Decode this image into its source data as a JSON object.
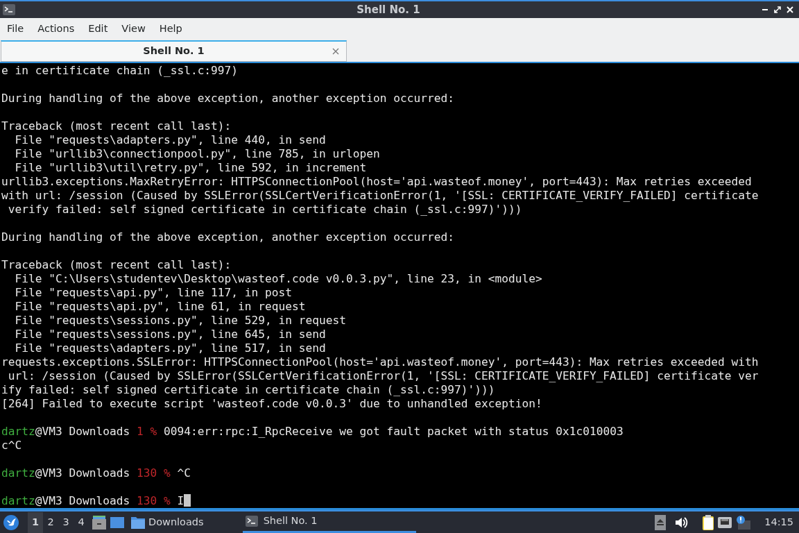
{
  "window": {
    "title": "Shell No. 1"
  },
  "menu": [
    "File",
    "Actions",
    "Edit",
    "View",
    "Help"
  ],
  "tabs": [
    {
      "label": "Shell No. 1",
      "selected": true
    }
  ],
  "terminal": {
    "lines": [
      {
        "kind": "output",
        "text": "e in certificate chain (_ssl.c:997)"
      },
      {
        "kind": "blank"
      },
      {
        "kind": "output",
        "text": "During handling of the above exception, another exception occurred:"
      },
      {
        "kind": "blank"
      },
      {
        "kind": "output",
        "text": "Traceback (most recent call last):"
      },
      {
        "kind": "output",
        "text": "  File \"requests\\adapters.py\", line 440, in send"
      },
      {
        "kind": "output",
        "text": "  File \"urllib3\\connectionpool.py\", line 785, in urlopen"
      },
      {
        "kind": "output",
        "text": "  File \"urllib3\\util\\retry.py\", line 592, in increment"
      },
      {
        "kind": "output",
        "text": "urllib3.exceptions.MaxRetryError: HTTPSConnectionPool(host='api.wasteof.money', port=443): Max retries exceeded"
      },
      {
        "kind": "output",
        "text": "with url: /session (Caused by SSLError(SSLCertVerificationError(1, '[SSL: CERTIFICATE_VERIFY_FAILED] certificate"
      },
      {
        "kind": "output",
        "text": " verify failed: self signed certificate in certificate chain (_ssl.c:997)')))"
      },
      {
        "kind": "blank"
      },
      {
        "kind": "output",
        "text": "During handling of the above exception, another exception occurred:"
      },
      {
        "kind": "blank"
      },
      {
        "kind": "output",
        "text": "Traceback (most recent call last):"
      },
      {
        "kind": "output",
        "text": "  File \"C:\\Users\\studentev\\Desktop\\wasteof.code v0.0.3.py\", line 23, in <module>"
      },
      {
        "kind": "output",
        "text": "  File \"requests\\api.py\", line 117, in post"
      },
      {
        "kind": "output",
        "text": "  File \"requests\\api.py\", line 61, in request"
      },
      {
        "kind": "output",
        "text": "  File \"requests\\sessions.py\", line 529, in request"
      },
      {
        "kind": "output",
        "text": "  File \"requests\\sessions.py\", line 645, in send"
      },
      {
        "kind": "output",
        "text": "  File \"requests\\adapters.py\", line 517, in send"
      },
      {
        "kind": "output",
        "text": "requests.exceptions.SSLError: HTTPSConnectionPool(host='api.wasteof.money', port=443): Max retries exceeded with"
      },
      {
        "kind": "output",
        "text": " url: /session (Caused by SSLError(SSLCertVerificationError(1, '[SSL: CERTIFICATE_VERIFY_FAILED] certificate ver"
      },
      {
        "kind": "output",
        "text": "ify failed: self signed certificate in certificate chain (_ssl.c:997)')))"
      },
      {
        "kind": "output",
        "text": "[264] Failed to execute script 'wasteof.code v0.0.3' due to unhandled exception!"
      },
      {
        "kind": "blank"
      },
      {
        "kind": "prompt",
        "user": "dartz",
        "host": "@VM3",
        "dir": "Downloads",
        "status": "1",
        "sign": "%",
        "command": "0094:err:rpc:I_RpcReceive we got fault packet with status 0x1c010003"
      },
      {
        "kind": "output",
        "text": "c^C"
      },
      {
        "kind": "blank"
      },
      {
        "kind": "prompt",
        "user": "dartz",
        "host": "@VM3",
        "dir": "Downloads",
        "status": "130",
        "sign": "%",
        "command": "^C"
      },
      {
        "kind": "blank"
      },
      {
        "kind": "prompt",
        "user": "dartz",
        "host": "@VM3",
        "dir": "Downloads",
        "status": "130",
        "sign": "%",
        "command": "I",
        "cursor": true
      }
    ]
  },
  "taskbar": {
    "workspaces": [
      {
        "label": "1",
        "selected": true
      },
      {
        "label": "2",
        "selected": false
      },
      {
        "label": "3",
        "selected": false
      },
      {
        "label": "4",
        "selected": false
      }
    ],
    "launchers": [
      {
        "label": "Downloads"
      }
    ],
    "tasks": [
      {
        "label": "Shell No. 1",
        "selected": true
      }
    ],
    "clock": "14:15"
  }
}
